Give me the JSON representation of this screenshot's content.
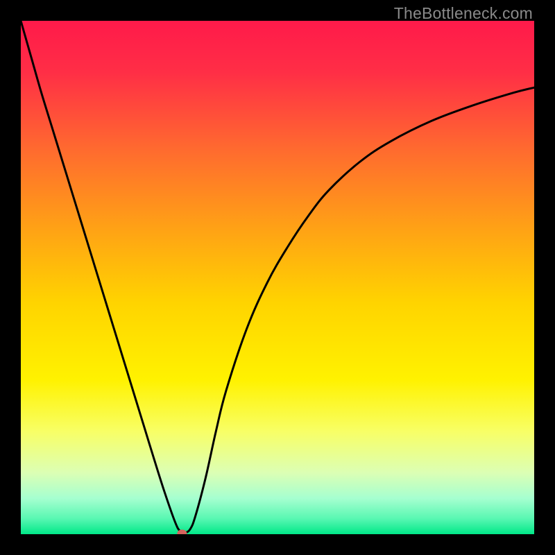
{
  "watermark": "TheBottleneck.com",
  "chart_data": {
    "type": "line",
    "title": "",
    "xlabel": "",
    "ylabel": "",
    "xlim": [
      0,
      100
    ],
    "ylim": [
      0,
      100
    ],
    "gradient_stops": [
      {
        "pos": 0.0,
        "color": "#ff1a4a"
      },
      {
        "pos": 0.1,
        "color": "#ff2e46"
      },
      {
        "pos": 0.25,
        "color": "#ff6a2f"
      },
      {
        "pos": 0.4,
        "color": "#ffa016"
      },
      {
        "pos": 0.55,
        "color": "#ffd400"
      },
      {
        "pos": 0.7,
        "color": "#fff200"
      },
      {
        "pos": 0.8,
        "color": "#f8ff66"
      },
      {
        "pos": 0.88,
        "color": "#dcffb4"
      },
      {
        "pos": 0.93,
        "color": "#a6ffd0"
      },
      {
        "pos": 0.97,
        "color": "#58f7b2"
      },
      {
        "pos": 1.0,
        "color": "#00e888"
      }
    ],
    "series": [
      {
        "name": "curve",
        "x": [
          0,
          2,
          4,
          6,
          8,
          10,
          12,
          14,
          16,
          18,
          20,
          22,
          24,
          26,
          28,
          30,
          31,
          32,
          33,
          34,
          36,
          38,
          40,
          44,
          48,
          52,
          56,
          60,
          66,
          72,
          80,
          88,
          96,
          100
        ],
        "y": [
          100,
          93,
          86,
          79.5,
          73,
          66.5,
          60,
          53.5,
          47,
          40.5,
          34,
          27.5,
          21,
          14.5,
          8.2,
          2.5,
          0.6,
          0.3,
          1.0,
          3.5,
          11,
          20,
          28,
          40,
          49,
          56,
          62,
          67,
          72.5,
          76.5,
          80.5,
          83.5,
          86,
          87
        ]
      }
    ],
    "marker": {
      "x": 31.4,
      "y": 0.15,
      "color": "#d4645d"
    }
  }
}
